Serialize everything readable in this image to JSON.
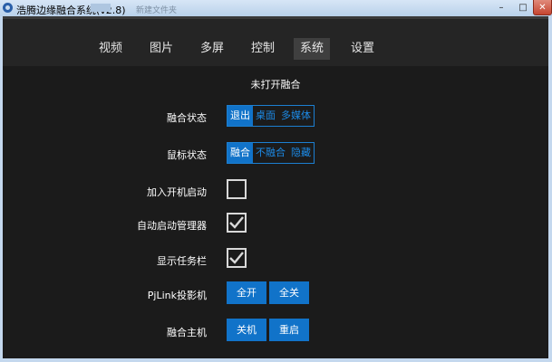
{
  "window": {
    "title": "浩腾边缘融合系统(v2.8)",
    "background_tab_text": "新建文件夹",
    "controls": {
      "minimize": "–",
      "maximize": "□",
      "close": "✕"
    }
  },
  "nav": {
    "tabs": [
      {
        "label": "视频"
      },
      {
        "label": "图片"
      },
      {
        "label": "多屏"
      },
      {
        "label": "控制"
      },
      {
        "label": "系统",
        "active": true
      },
      {
        "label": "设置"
      }
    ]
  },
  "system": {
    "status_text": "未打开融合",
    "fusion_state": {
      "label": "融合状态",
      "options": [
        "退出",
        "桌面",
        "多媒体"
      ],
      "selected": "退出"
    },
    "mouse_state": {
      "label": "鼠标状态",
      "options": [
        "融合",
        "不融合",
        "隐藏"
      ],
      "selected": "融合"
    },
    "startup": {
      "label": "加入开机启动",
      "checked": false
    },
    "auto_manager": {
      "label": "自动启动管理器",
      "checked": true
    },
    "show_taskbar": {
      "label": "显示任务栏",
      "checked": true
    },
    "pjlink": {
      "label": "PjLink投影机",
      "on_label": "全开",
      "off_label": "全关"
    },
    "fusion_host": {
      "label": "融合主机",
      "shutdown_label": "关机",
      "restart_label": "重启"
    }
  },
  "colors": {
    "accent": "#1173c9",
    "accent_text": "#1c8ae6",
    "panel_bg": "#1b1b1b",
    "nav_bg": "#252525"
  },
  "icons": {
    "check": "✓"
  }
}
